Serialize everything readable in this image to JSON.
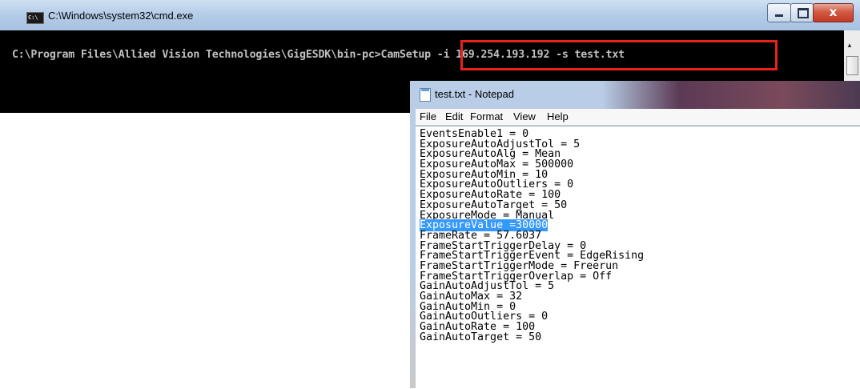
{
  "cmd": {
    "title": "C:\\Windows\\system32\\cmd.exe",
    "icon": "cmd-console-icon",
    "prompt": "C:\\Program Files\\Allied Vision Technologies\\GigESDK\\bin-pc>CamSetup -i 169.254.193.192 -s test.txt",
    "highlight_color": "#e8211c"
  },
  "notepad": {
    "title": "test.txt - Notepad",
    "icon": "notepad-icon",
    "menu": [
      "File",
      "Edit",
      "Format",
      "View",
      "Help"
    ],
    "selection_color": "#3399ff",
    "lines": [
      "EventsEnable1 = 0",
      "ExposureAutoAdjustTol = 5",
      "ExposureAutoAlg = Mean",
      "ExposureAutoMax = 500000",
      "ExposureAutoMin = 10",
      "ExposureAutoOutliers = 0",
      "ExposureAutoRate = 100",
      "ExposureAutoTarget = 50",
      "ExposureMode = Manual",
      "ExposureValue =30000",
      "FrameRate = 57.6037",
      "FrameStartTriggerDelay = 0",
      "FrameStartTriggerEvent = EdgeRising",
      "FrameStartTriggerMode = Freerun",
      "FrameStartTriggerOverlap = Off",
      "GainAutoAdjustTol = 5",
      "GainAutoMax = 32",
      "GainAutoMin = 0",
      "GainAutoOutliers = 0",
      "GainAutoRate = 100",
      "GainAutoTarget = 50"
    ],
    "selected_line": 9
  }
}
